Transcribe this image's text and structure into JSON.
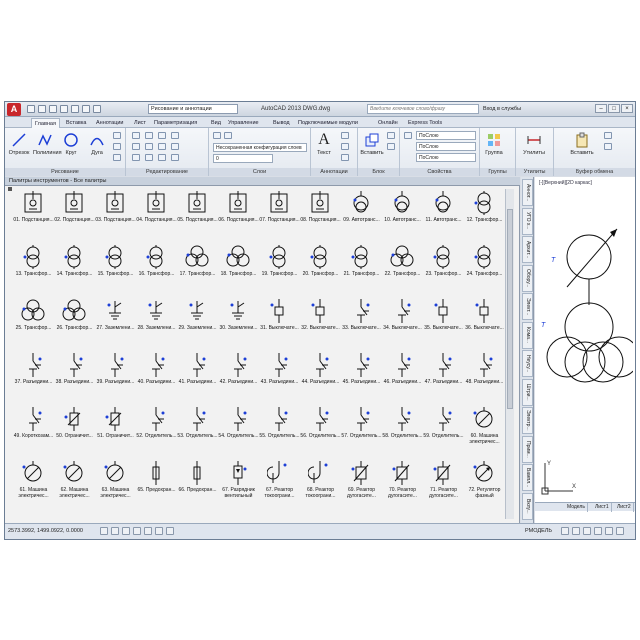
{
  "title_bar": {
    "workspace": "Рисование и аннотации",
    "app_title": "AutoCAD 2013   DWG.dwg",
    "search_placeholder": "Введите ключевое слово/фразу",
    "signin": "Вход в службы"
  },
  "ribbon_tabs": [
    "Главная",
    "Вставка",
    "Аннотации",
    "Лист",
    "Параметризация",
    "Вид",
    "Управление",
    "Вывод",
    "Подключаемые модули",
    "Онлайн",
    "Express Tools"
  ],
  "ribbon": {
    "draw_tools": [
      "Отрезок",
      "Полилиния",
      "Круг",
      "Дуга"
    ],
    "panels": [
      "Рисование",
      "Редактирование",
      "Слои",
      "Аннотации",
      "Блок",
      "Свойства",
      "Группы",
      "Утилиты",
      "Буфер обмена"
    ],
    "layer_state": "Несохраненная конфигурация слоев",
    "layer_value": "0",
    "text_tool": "Текст",
    "insert_tool": "Вставить",
    "group_tool": "Группа",
    "utilities_tool": "Утилиты",
    "paste_tool": "Вставить",
    "prop_color": "ПоСлою",
    "prop_linetype": "ПоСлою",
    "prop_lineweight": "ПоСлою"
  },
  "palette": {
    "title": "Палитры инструментов - Все палитры",
    "items": [
      {
        "label": "01. Подстанция...",
        "kind": "sub"
      },
      {
        "label": "02. Подстанция...",
        "kind": "sub"
      },
      {
        "label": "03. Подстанция...",
        "kind": "sub"
      },
      {
        "label": "04. Подстанция...",
        "kind": "sub"
      },
      {
        "label": "05. Подстанция...",
        "kind": "sub"
      },
      {
        "label": "06. Подстанция...",
        "kind": "sub"
      },
      {
        "label": "07. Подстанция...",
        "kind": "sub"
      },
      {
        "label": "08. Подстанция...",
        "kind": "sub"
      },
      {
        "label": "09. Автотранс...",
        "kind": "auto"
      },
      {
        "label": "10. Автотранс...",
        "kind": "auto"
      },
      {
        "label": "11. Автотранс...",
        "kind": "auto"
      },
      {
        "label": "12. Трансфор...",
        "kind": "tr2"
      },
      {
        "label": "13. Трансфор...",
        "kind": "tr2"
      },
      {
        "label": "14. Трансфор...",
        "kind": "tr2"
      },
      {
        "label": "15. Трансфор...",
        "kind": "tr2"
      },
      {
        "label": "16. Трансфор...",
        "kind": "tr2"
      },
      {
        "label": "17. Трансфор...",
        "kind": "tr3"
      },
      {
        "label": "18. Трансфор...",
        "kind": "tr3"
      },
      {
        "label": "19. Трансфор...",
        "kind": "tr2"
      },
      {
        "label": "20. Трансфор...",
        "kind": "tr2"
      },
      {
        "label": "21. Трансфор...",
        "kind": "tr2"
      },
      {
        "label": "22. Трансфор...",
        "kind": "tr3"
      },
      {
        "label": "23. Трансфор...",
        "kind": "tr2"
      },
      {
        "label": "24. Трансфор...",
        "kind": "tr2"
      },
      {
        "label": "25. Трансфор...",
        "kind": "tr3"
      },
      {
        "label": "26. Трансфор...",
        "kind": "tr3"
      },
      {
        "label": "27. Заземлени...",
        "kind": "gnd"
      },
      {
        "label": "28. Заземлени...",
        "kind": "gnd"
      },
      {
        "label": "29. Заземлени...",
        "kind": "gnd"
      },
      {
        "label": "30. Заземлени...",
        "kind": "gnd"
      },
      {
        "label": "31. Выключате...",
        "kind": "brk"
      },
      {
        "label": "32. Выключате...",
        "kind": "brk"
      },
      {
        "label": "33. Выключате...",
        "kind": "sw"
      },
      {
        "label": "34. Выключате...",
        "kind": "sw"
      },
      {
        "label": "35. Выключате...",
        "kind": "brk"
      },
      {
        "label": "36. Выключате...",
        "kind": "brk"
      },
      {
        "label": "37. Разъедини...",
        "kind": "sw"
      },
      {
        "label": "38. Разъедини...",
        "kind": "sw"
      },
      {
        "label": "39. Разъедини...",
        "kind": "sw"
      },
      {
        "label": "40. Разъедини...",
        "kind": "sw"
      },
      {
        "label": "41. Разъедини...",
        "kind": "sw"
      },
      {
        "label": "42. Разъедини...",
        "kind": "sw"
      },
      {
        "label": "43. Разъедини...",
        "kind": "sw"
      },
      {
        "label": "44. Разъедини...",
        "kind": "sw"
      },
      {
        "label": "45. Разъедини...",
        "kind": "sw"
      },
      {
        "label": "46. Разъедини...",
        "kind": "sw"
      },
      {
        "label": "47. Разъедини...",
        "kind": "sw"
      },
      {
        "label": "48. Разъедини...",
        "kind": "sw"
      },
      {
        "label": "49. Короткозам...",
        "kind": "sw"
      },
      {
        "label": "50. Ограничит...",
        "kind": "res"
      },
      {
        "label": "51. Ограничит...",
        "kind": "res"
      },
      {
        "label": "52. Отделитель...",
        "kind": "sw"
      },
      {
        "label": "53. Отделитель...",
        "kind": "sw"
      },
      {
        "label": "54. Отделитель...",
        "kind": "sw"
      },
      {
        "label": "55. Отделитель...",
        "kind": "sw"
      },
      {
        "label": "56. Отделитель...",
        "kind": "sw"
      },
      {
        "label": "57. Отделитель...",
        "kind": "sw"
      },
      {
        "label": "58. Отделитель...",
        "kind": "sw"
      },
      {
        "label": "59. Отделитель...",
        "kind": "sw"
      },
      {
        "label": "60. Машина электричес...",
        "kind": "mach"
      },
      {
        "label": "61. Машина электричес...",
        "kind": "mach"
      },
      {
        "label": "62. Машина электричес...",
        "kind": "mach"
      },
      {
        "label": "63. Машина электричес...",
        "kind": "mach"
      },
      {
        "label": "65. Предохран...",
        "kind": "fuse"
      },
      {
        "label": "66. Предохран...",
        "kind": "fuse"
      },
      {
        "label": "67. Разрядник вентильный",
        "kind": "arr"
      },
      {
        "label": "67. Реактор токоограни...",
        "kind": "reac"
      },
      {
        "label": "68. Реактор токоограни...",
        "kind": "reac"
      },
      {
        "label": "69. Реактор дугогасите...",
        "kind": "dug"
      },
      {
        "label": "70. Реактор дугогасите...",
        "kind": "dug"
      },
      {
        "label": "71. Реактор дугогасите...",
        "kind": "dug"
      },
      {
        "label": "72. Регулятор фазный",
        "kind": "reg"
      }
    ]
  },
  "side_tabs": [
    "Аннот...",
    "УГО х...",
    "Архит...",
    "Обору...",
    "Элект...",
    "Кома...",
    "Неусу...",
    "Штри...",
    "Электр...",
    "Прим...",
    "Вампл...",
    "Вклу..."
  ],
  "viewport": {
    "label": "[-][Верхний][2D каркас]",
    "tabs": [
      "Модель",
      "Лист1",
      "Лист2"
    ]
  },
  "status": {
    "coords": "2573.3992, 1499.0922, 0.0000",
    "model": "РМОДЕЛЬ"
  },
  "colors": {
    "accent_blue": "#1d3fd6",
    "logo_red": "#c8262b"
  }
}
